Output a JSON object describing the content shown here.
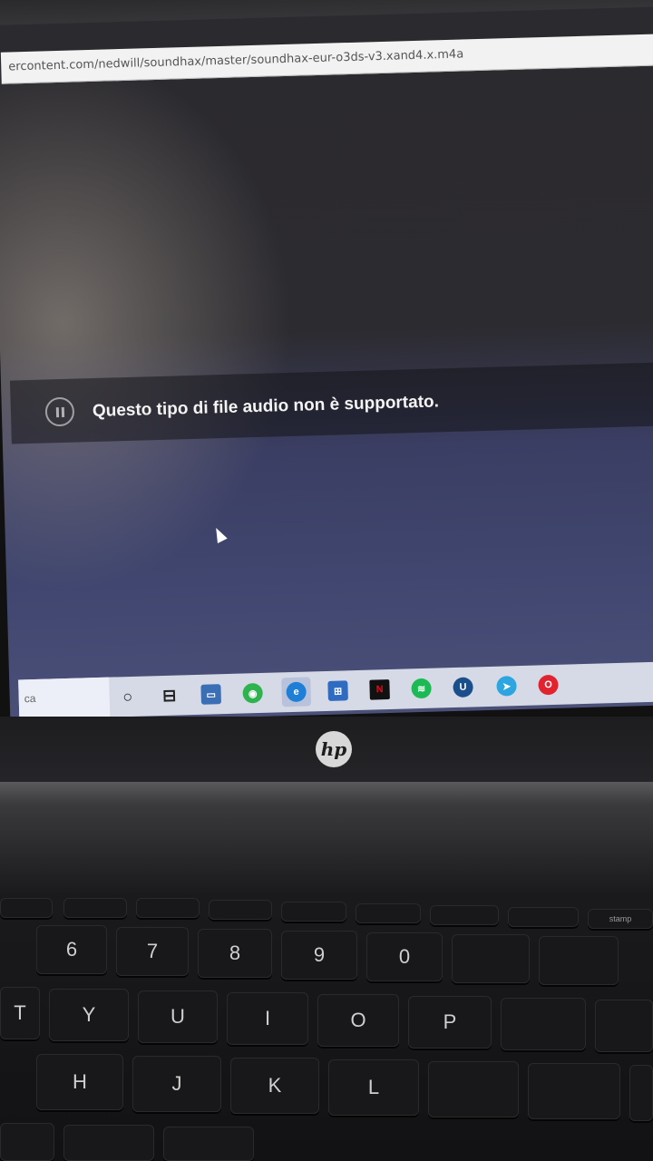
{
  "browser": {
    "url": "ercontent.com/nedwill/soundhax/master/soundhax-eur-o3ds-v3.xand4.x.m4a"
  },
  "player": {
    "message": "Questo tipo di file audio non è supportato."
  },
  "taskbar": {
    "search_text": "ca",
    "items": [
      {
        "name": "cortana",
        "glyph": "○"
      },
      {
        "name": "task-view",
        "glyph": "⊟"
      },
      {
        "name": "file-explorer",
        "glyph": "▭"
      },
      {
        "name": "whatsapp",
        "glyph": "◉"
      },
      {
        "name": "edge",
        "glyph": "e"
      },
      {
        "name": "store",
        "glyph": "⊞"
      },
      {
        "name": "netflix",
        "glyph": "N"
      },
      {
        "name": "spotify",
        "glyph": "≋"
      },
      {
        "name": "u-app",
        "glyph": "U"
      },
      {
        "name": "telegram",
        "glyph": "➤"
      },
      {
        "name": "opera",
        "glyph": "O"
      }
    ]
  },
  "laptop": {
    "logo": "hp"
  },
  "keyboard": {
    "row1": [
      "6",
      "7",
      "8",
      "9",
      "0"
    ],
    "row2": [
      "T",
      "Y",
      "U",
      "I",
      "O",
      "P"
    ],
    "row3": [
      "H",
      "J",
      "K",
      "L"
    ],
    "fn_labels": [
      "stamp"
    ]
  }
}
